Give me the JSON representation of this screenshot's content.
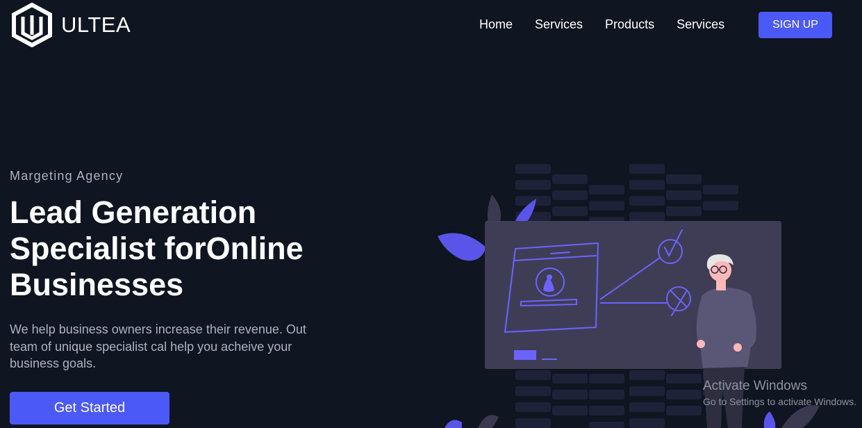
{
  "brand": {
    "name": "ULTEA",
    "logo_icon": "hexagon-u-logo-icon"
  },
  "nav": {
    "links": [
      "Home",
      "Services",
      "Products",
      "Services"
    ],
    "signup_label": "SIGN UP"
  },
  "hero": {
    "topline": "Margeting Agency",
    "heading": "Lead Generation Specialist forOnline Businesses",
    "subtitle": "We help business owners increase their revenue. Out team of unique specialist cal help you acheive your business goals.",
    "cta_label": "Get Started",
    "illustration_icon": "presenter-whiteboard-illustration"
  },
  "watermark": {
    "title": "Activate Windows",
    "subtitle": "Go to Settings to activate Windows."
  },
  "colors": {
    "background": "#101522",
    "accent": "#4b59f7",
    "muted_text": "#a9b3c1",
    "board": "#3f3d56"
  }
}
